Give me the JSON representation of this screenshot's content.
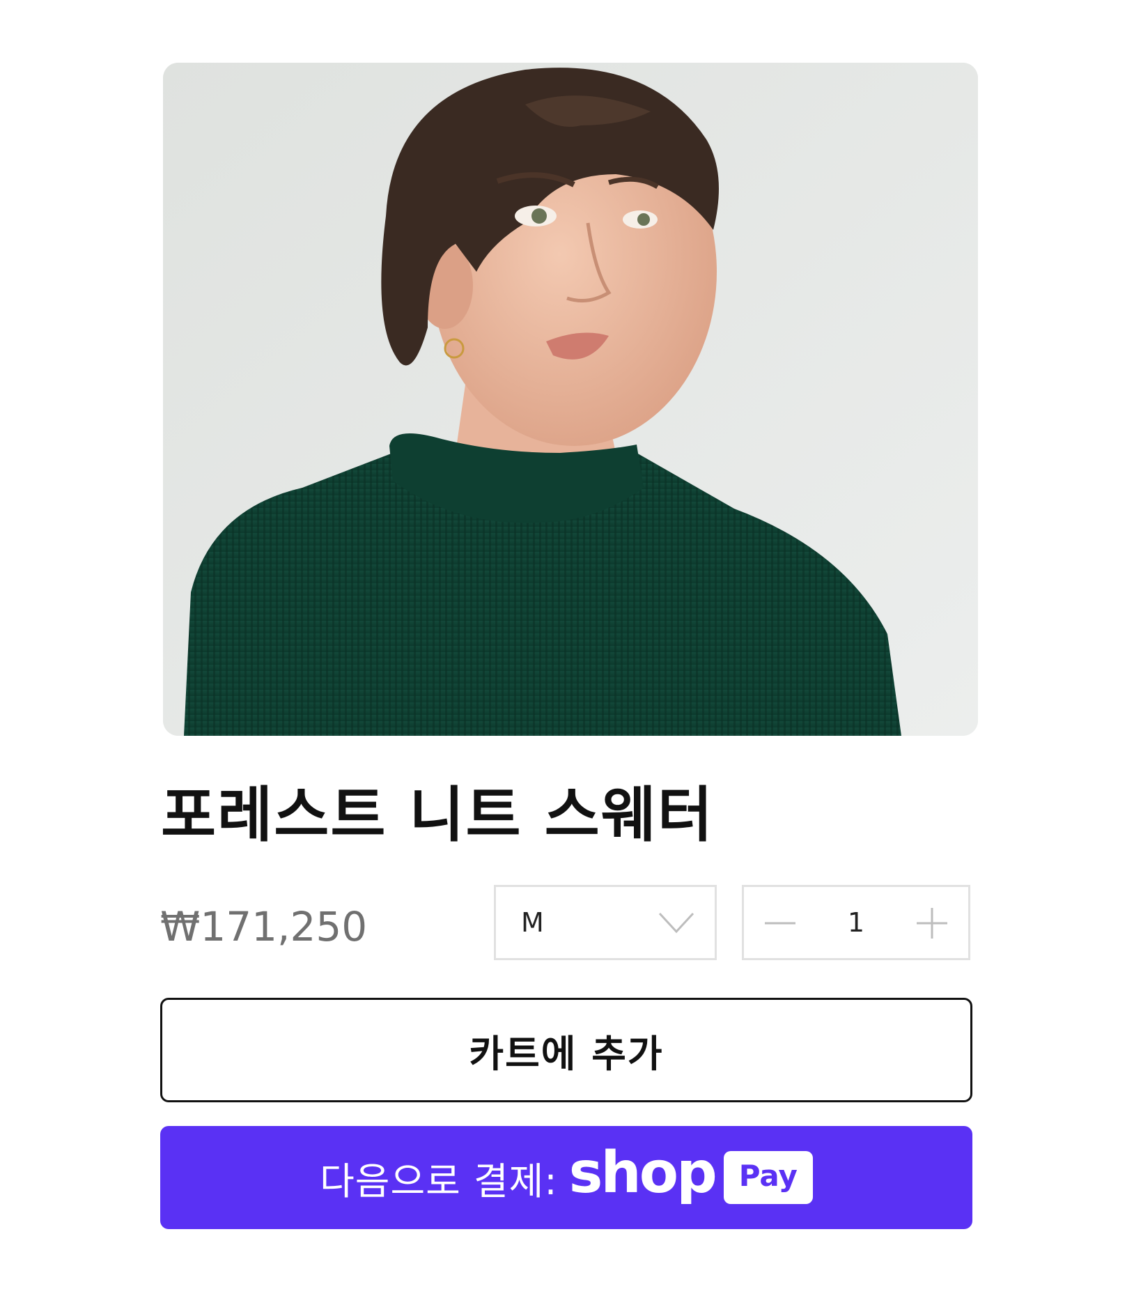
{
  "product": {
    "image_alt": "product-photo",
    "title": "포레스트 니트 스웨터",
    "price": "₩171,250"
  },
  "size_select": {
    "selected": "M",
    "icon": "chevron-down-icon"
  },
  "quantity": {
    "value": "1",
    "minus_icon": "minus-icon",
    "plus_icon": "plus-icon"
  },
  "add_to_cart": {
    "label": "카트에 추가"
  },
  "shop_pay": {
    "label": "다음으로 결제:",
    "brand": "shop",
    "badge": "Pay",
    "color": "#5a31f4"
  }
}
